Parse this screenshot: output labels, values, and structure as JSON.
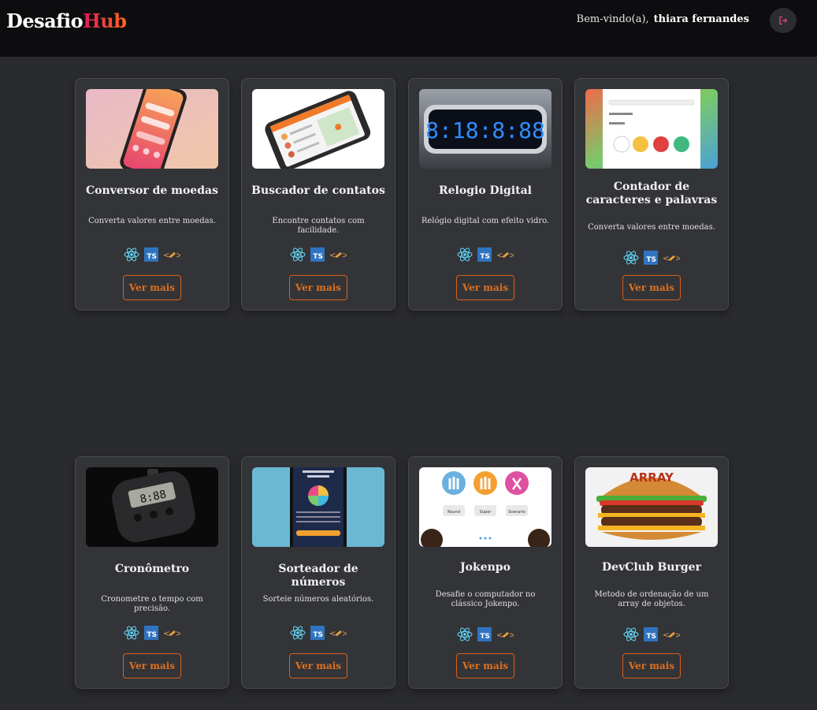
{
  "header": {
    "logo_part1": "Desafio",
    "logo_part2": "Hub",
    "welcome": "Bem-vindo(a),",
    "user": "thiara fernandes"
  },
  "cards": [
    {
      "title": "Conversor de moedas",
      "desc": "Converta valores entre moedas.",
      "button": "Ver mais"
    },
    {
      "title": "Buscador de contatos",
      "desc": "Encontre contatos com facilidade.",
      "button": "Ver mais"
    },
    {
      "title": "Relogio Digital",
      "desc": "Relógio digital com efeito vidro.",
      "button": "Ver mais"
    },
    {
      "title": "Contador de caracteres e palavras",
      "desc": "Converta valores entre moedas.",
      "button": "Ver mais"
    },
    {
      "title": "Cronômetro",
      "desc": "Cronometre o tempo com precisão.",
      "button": "Ver mais"
    },
    {
      "title": "Sorteador de números",
      "desc": "Sorteie números aleatórios.",
      "button": "Ver mais"
    },
    {
      "title": "Jokenpo",
      "desc": "Desafie o computador no clássico Jokenpo.",
      "button": "Ver mais"
    },
    {
      "title": "DevClub Burger",
      "desc": "Metodo de ordenação de um array de objetos.",
      "button": "Ver mais"
    }
  ],
  "thumb_texts": {
    "clock_digits": "8:18:8:88",
    "stopwatch_digits": "8:88",
    "burger_label": "ARRAY",
    "jokenpo_buttons": [
      "Round",
      "Super",
      "Scenario"
    ]
  },
  "tech_icons": [
    "react-icon",
    "typescript-icon",
    "styled-components-icon"
  ],
  "colors": {
    "accent": "#e0711f",
    "brand_gradient_start": "#e0195a",
    "brand_gradient_end": "#ff6a1a",
    "background": "#2a2b2f",
    "card": "#333438"
  }
}
